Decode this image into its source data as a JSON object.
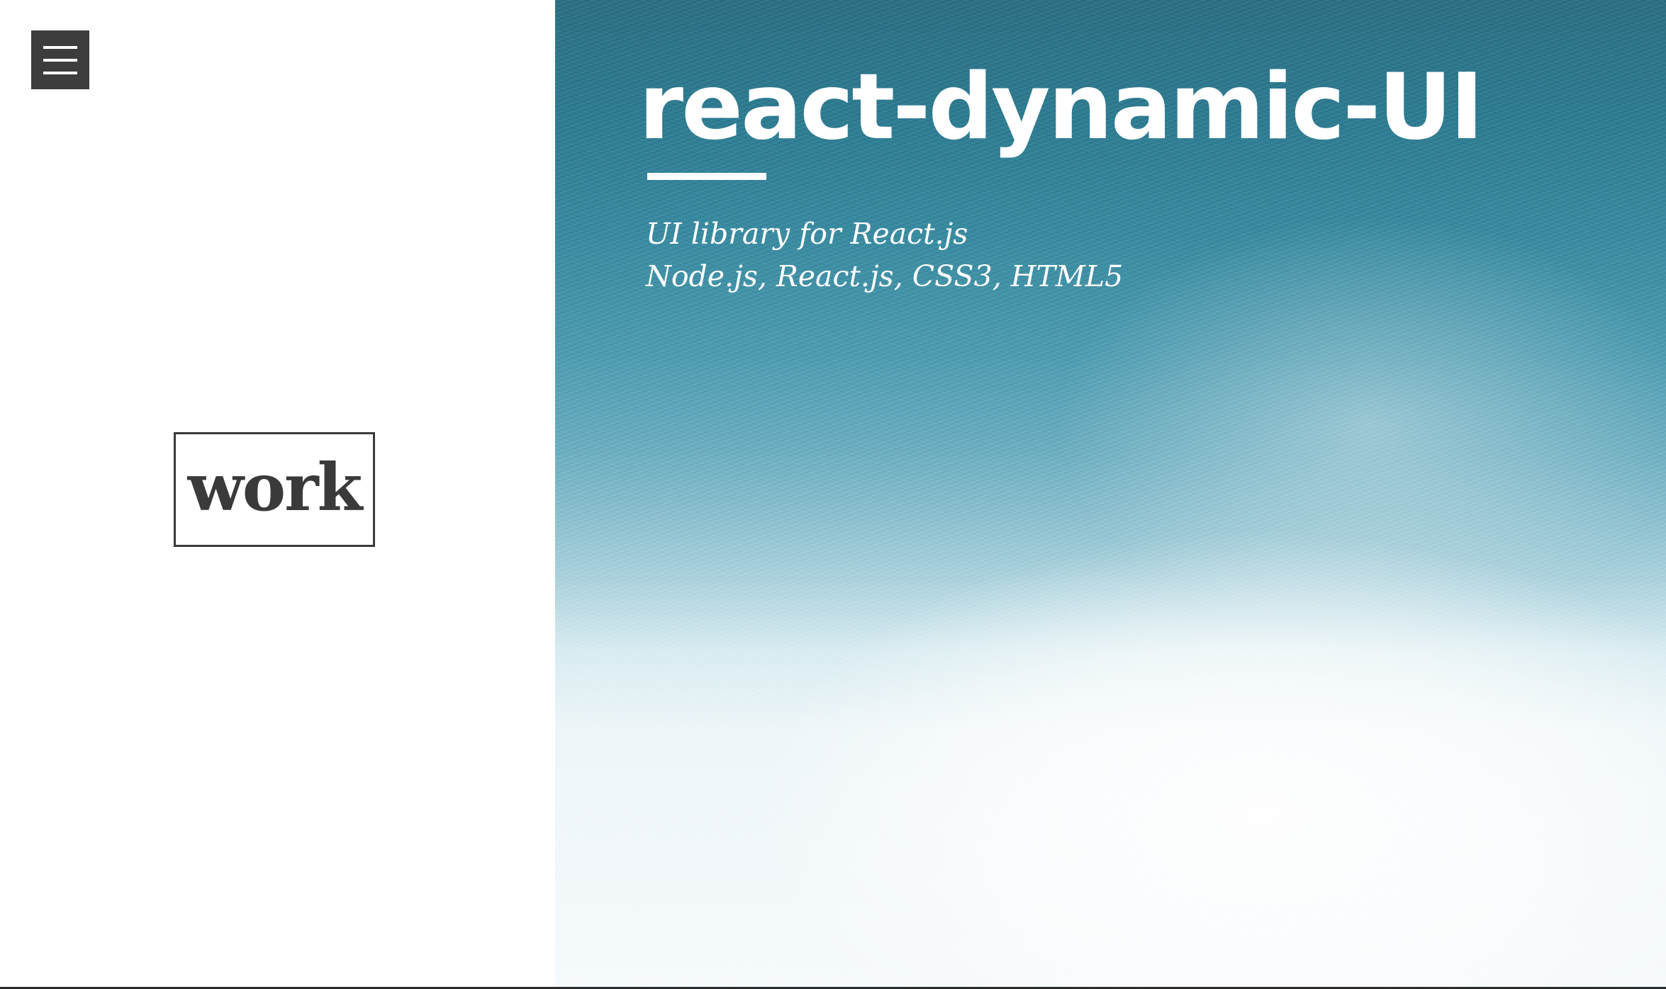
{
  "nav": {
    "menu_icon": "hamburger-menu-icon"
  },
  "work_link": {
    "label": "work"
  },
  "hero": {
    "title": "react-dynamic-UI",
    "subtitle_lines": [
      "UI library for React.js",
      "Node.js, React.js, CSS3, HTML5"
    ]
  },
  "colors": {
    "menu_button_bg": "#3d3d3d",
    "text_dark": "#3a3a3a",
    "hero_top": "#2e6f82",
    "hero_bottom": "#f6fafc",
    "hero_text": "#ffffff"
  }
}
